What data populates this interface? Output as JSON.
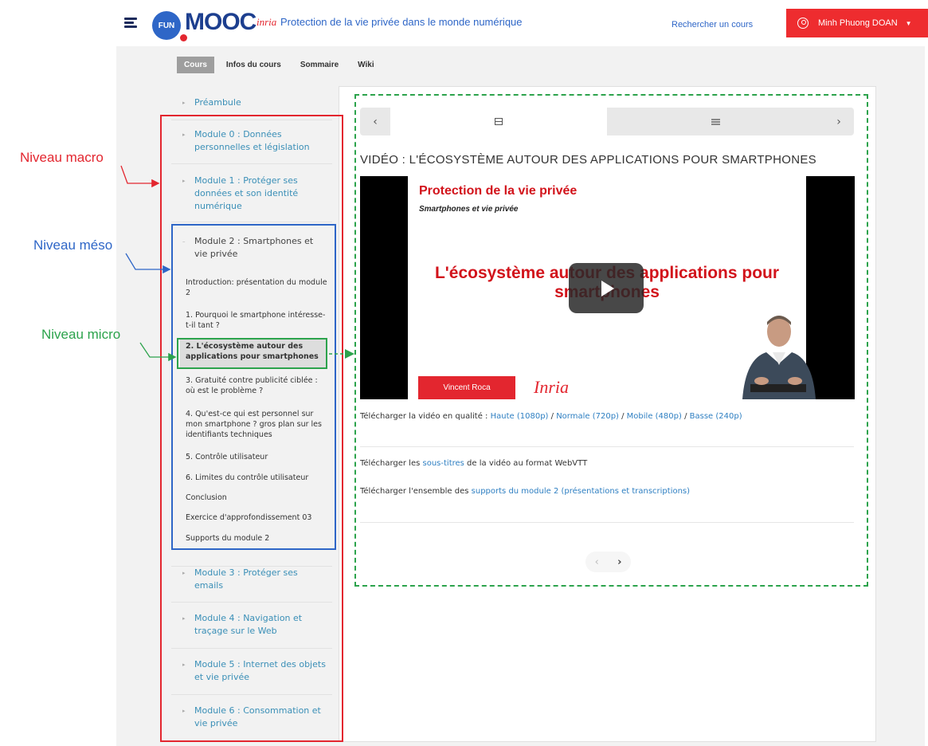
{
  "header": {
    "logo_badge": "FUN",
    "logo_text": "MOOC",
    "partner": "inria",
    "course_title": "Protection de la vie privée dans le monde numérique",
    "search_link": "Rechercher un cours",
    "user_name": "Minh Phuong DOAN"
  },
  "tabs": [
    {
      "label": "Cours",
      "active": true
    },
    {
      "label": "Infos du cours"
    },
    {
      "label": "Sommaire"
    },
    {
      "label": "Wiki"
    }
  ],
  "sidebar": {
    "modules": [
      {
        "label": "Préambule"
      },
      {
        "label": "Module 0 : Données personnelles et législation"
      },
      {
        "label": "Module 1 : Protéger ses données et son identité numérique"
      },
      {
        "label": "Module 2 : Smartphones et vie privée",
        "open": true
      },
      {
        "label": "Module 3 : Protéger ses emails"
      },
      {
        "label": "Module 4 : Navigation et traçage sur le Web"
      },
      {
        "label": "Module 5 : Internet des objets et vie privée"
      },
      {
        "label": "Module 6 : Consommation et vie privée"
      }
    ],
    "subsections": [
      {
        "label": "Introduction: présentation du module 2"
      },
      {
        "label": "1. Pourquoi le smartphone intéresse-t-il tant ?"
      },
      {
        "label": "2. L'écosystème autour des applications pour smartphones",
        "active": true
      },
      {
        "label": "3. Gratuité contre publicité ciblée : où est le problème ?"
      },
      {
        "label": "4. Qu'est-ce qui est personnel sur mon smartphone ? gros plan sur les identifiants techniques"
      },
      {
        "label": "5. Contrôle utilisateur"
      },
      {
        "label": "6. Limites du contrôle utilisateur"
      },
      {
        "label": "Conclusion"
      },
      {
        "label": "Exercice d'approfondissement 03"
      },
      {
        "label": "Supports du module 2"
      }
    ]
  },
  "main": {
    "seq_nav": {
      "prev": "‹",
      "next": "›",
      "tabs": [
        {
          "icon": "film-icon",
          "active": true
        },
        {
          "icon": "list-icon"
        }
      ]
    },
    "video_title": "VIDÉO : L'ÉCOSYSTÈME AUTOUR DES APPLICATIONS POUR SMARTPHONES",
    "slide": {
      "title": "Protection de la vie privée",
      "subtitle": "Smartphones et vie privée",
      "main_text": "L'écosystème autour des applications pour smartphones",
      "presenter": "Vincent Roca",
      "logo": "Inria"
    },
    "download_video": {
      "prefix": "Télécharger la vidéo en qualité : ",
      "links": [
        "Haute (1080p)",
        "Normale (720p)",
        "Mobile (480p)",
        "Basse (240p)"
      ],
      "separator": " / "
    },
    "download_subtitles": {
      "prefix": "Télécharger les ",
      "link": "sous-titres",
      "suffix": " de la vidéo au format WebVTT"
    },
    "download_supports": {
      "prefix": "Télécharger l'ensemble des ",
      "link": "supports du module 2 (présentations et transcriptions)"
    },
    "bottom_nav": {
      "prev": "‹",
      "next": "›"
    }
  },
  "annotations": {
    "macro": "Niveau macro",
    "meso": "Niveau méso",
    "micro": "Niveau micro"
  },
  "colors": {
    "brand_red": "#e3262f",
    "brand_blue": "#2e66c7",
    "link_blue": "#3a8fb7",
    "annotation_green": "#2ca34c"
  }
}
